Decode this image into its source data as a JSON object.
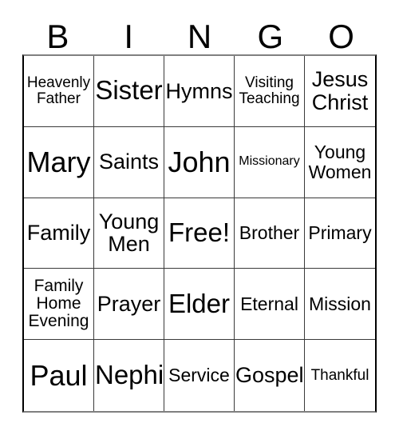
{
  "card": {
    "title": "BINGO",
    "header_letters": [
      "B",
      "I",
      "N",
      "G",
      "O"
    ],
    "free_space_label": "Free!",
    "colors": {
      "background": "#ffffff",
      "text": "#000000",
      "grid_line": "#3a3a3a",
      "outer_border": "#000000",
      "outer_border_shadow": "#808080"
    },
    "grid": {
      "columns": 5,
      "rows": 5,
      "rows_data": [
        [
          {
            "text": "Heavenly\nFather",
            "size": "xxs",
            "lines": 2
          },
          {
            "text": "Sister",
            "size": "xl",
            "lines": 1
          },
          {
            "text": "Hymns",
            "size": "md",
            "lines": 1
          },
          {
            "text": "Visiting\nTeaching",
            "size": "xxs",
            "lines": 2
          },
          {
            "text": "Jesus\nChrist",
            "size": "md",
            "lines": 2
          }
        ],
        [
          {
            "text": "Mary",
            "size": "xxl",
            "lines": 1
          },
          {
            "text": "Saints",
            "size": "md",
            "lines": 1
          },
          {
            "text": "John",
            "size": "xxl",
            "lines": 1
          },
          {
            "text": "Missionary",
            "size": "tiny",
            "lines": 1
          },
          {
            "text": "Young\nWomen",
            "size": "sm",
            "lines": 2
          }
        ],
        [
          {
            "text": "Family",
            "size": "md",
            "lines": 1
          },
          {
            "text": "Young\nMen",
            "size": "md",
            "lines": 2
          },
          {
            "text": "Free!",
            "size": "xl",
            "lines": 1
          },
          {
            "text": "Brother",
            "size": "sm",
            "lines": 1
          },
          {
            "text": "Primary",
            "size": "sm",
            "lines": 1
          }
        ],
        [
          {
            "text": "Family\nHome\nEvening",
            "size": "xs",
            "lines": 3
          },
          {
            "text": "Prayer",
            "size": "md",
            "lines": 1
          },
          {
            "text": "Elder",
            "size": "xl",
            "lines": 1
          },
          {
            "text": "Eternal",
            "size": "sm",
            "lines": 1
          },
          {
            "text": "Mission",
            "size": "sm",
            "lines": 1
          }
        ],
        [
          {
            "text": "Paul",
            "size": "xxl",
            "lines": 1
          },
          {
            "text": "Nephi",
            "size": "xl",
            "lines": 1
          },
          {
            "text": "Service",
            "size": "sm",
            "lines": 1
          },
          {
            "text": "Gospel",
            "size": "md",
            "lines": 1
          },
          {
            "text": "Thankful",
            "size": "xxs",
            "lines": 1
          }
        ]
      ]
    }
  }
}
